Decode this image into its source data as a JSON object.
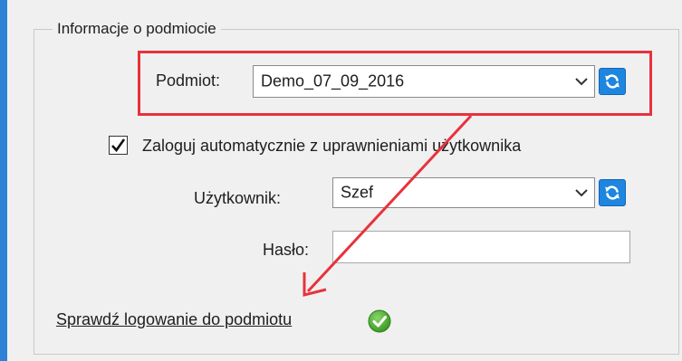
{
  "group": {
    "title": "Informacje o podmiocie"
  },
  "entity": {
    "label": "Podmiot:",
    "value": "Demo_07_09_2016"
  },
  "auto_login": {
    "label": "Zaloguj automatycznie z uprawnieniami użytkownika",
    "checked": true
  },
  "user": {
    "label": "Użytkownik:",
    "value": "Szef"
  },
  "password": {
    "label": "Hasło:",
    "value": ""
  },
  "check_link": {
    "label": "Sprawdź logowanie do podmiotu",
    "status_icon": "check-circle-icon"
  },
  "colors": {
    "accent": "#1e86e0",
    "highlight": "#e8323c",
    "ok": "#4caf34",
    "window_edge": "#2d82d6"
  }
}
